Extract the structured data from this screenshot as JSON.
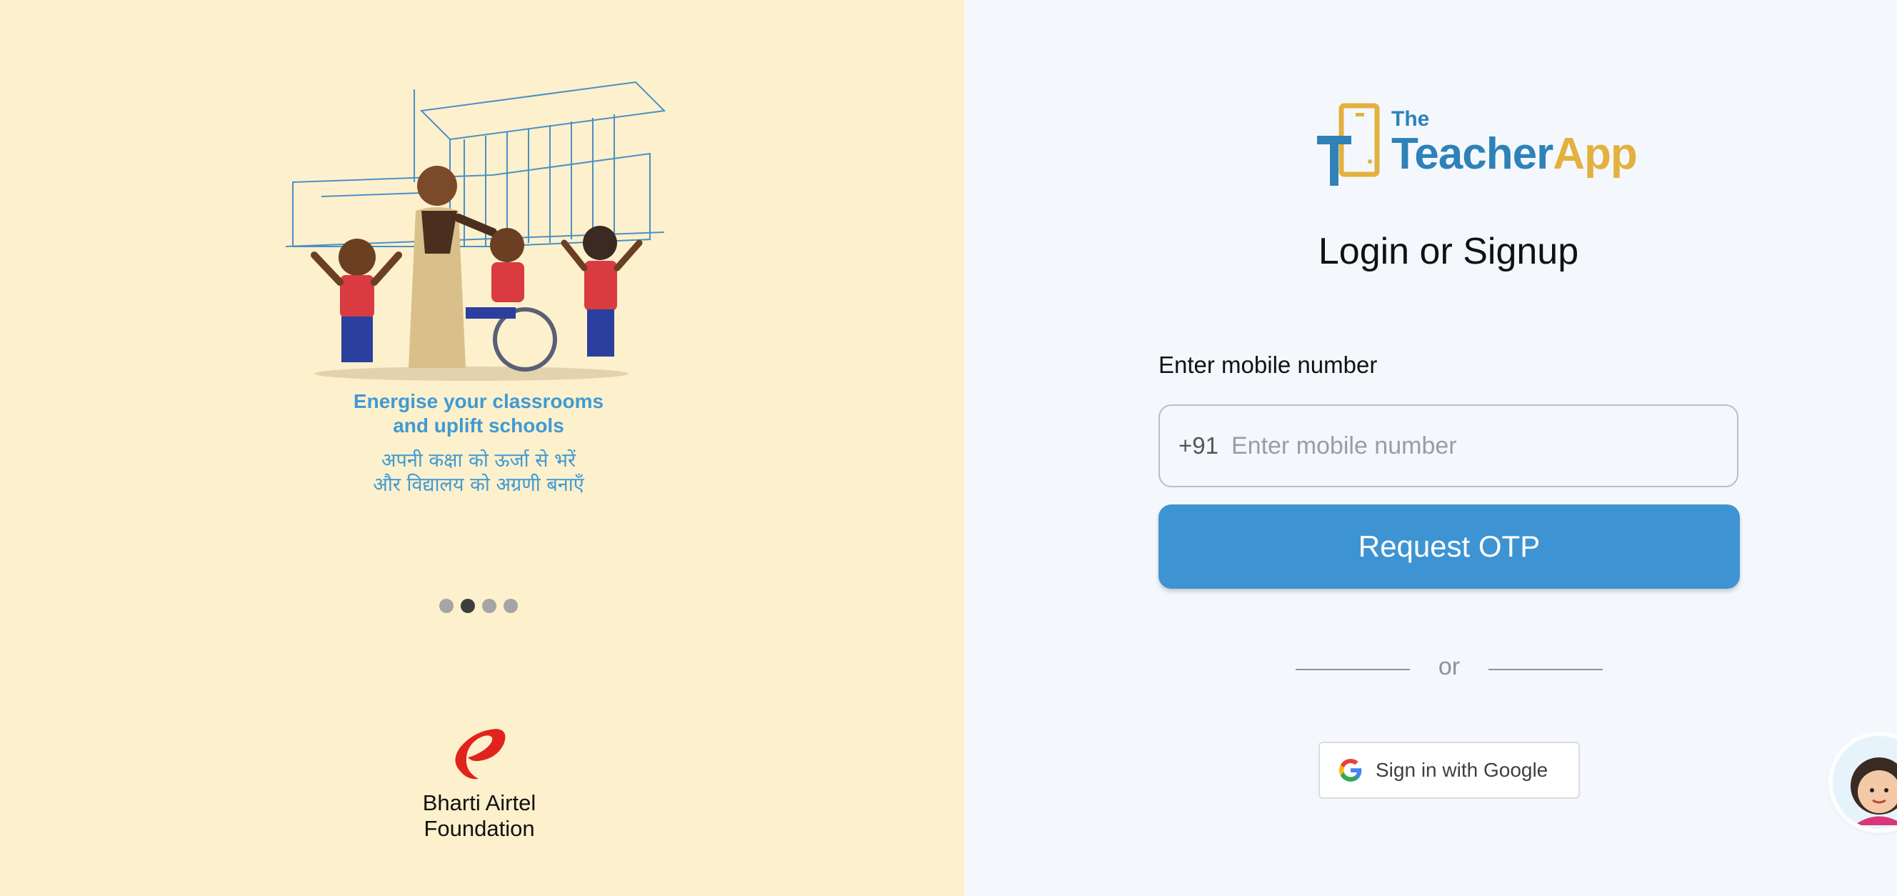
{
  "onboarding": {
    "tagline_en_line1": "Energise your classrooms",
    "tagline_en_line2": "and uplift schools",
    "tagline_hi_line1": "अपनी कक्षा को ऊर्जा से भरें",
    "tagline_hi_line2": "और विद्यालय को अग्रणी बनाएँ",
    "carousel": {
      "total": 4,
      "active": 2
    },
    "sponsor_line1": "Bharti Airtel",
    "sponsor_line2": "Foundation"
  },
  "brand": {
    "logo_the": "The",
    "logo_teacher": "Teacher",
    "logo_app": "App",
    "primary_color": "#2e82b8",
    "accent_color": "#e3b13f"
  },
  "login": {
    "title": "Login or Signup",
    "mobile_label": "Enter mobile number",
    "country_code": "+91",
    "mobile_placeholder": "Enter mobile number",
    "request_otp_label": "Request OTP",
    "divider_text": "or",
    "google_label": "Sign in with Google",
    "button_color": "#3e94d3"
  },
  "icons": {
    "google": "google-g-icon",
    "airtel": "airtel-logo-icon",
    "chat": "chat-assistant-avatar"
  }
}
